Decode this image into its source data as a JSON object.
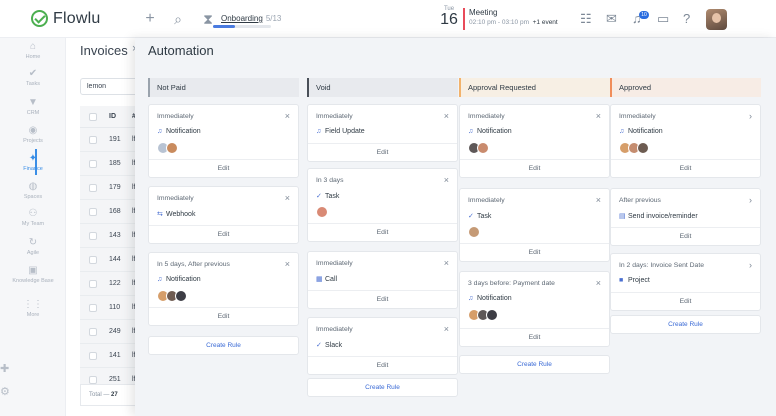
{
  "topbar": {
    "app_name": "Flowlu",
    "onboarding_label": "Onboarding",
    "onboarding_step": "5/13",
    "onboarding_progress": 0.38,
    "calendar_day": "Tue",
    "calendar_date": "16",
    "meeting_title": "Meeting",
    "meeting_time": "02:10 pm - 03:10 pm",
    "meeting_more": "+1 event",
    "notification_count": "10",
    "icons": [
      "plus-icon",
      "search-icon",
      "timer-icon",
      "checklist-icon",
      "mail-icon",
      "bell-icon",
      "chat-icon",
      "help-icon"
    ]
  },
  "sidebar": {
    "items": [
      {
        "label": "Home",
        "glyph": "⌂"
      },
      {
        "label": "Tasks",
        "glyph": "✔"
      },
      {
        "label": "CRM",
        "glyph": "▼"
      },
      {
        "label": "Projects",
        "glyph": "◉"
      },
      {
        "label": "Finance",
        "glyph": "✦"
      },
      {
        "label": "Spaces",
        "glyph": "◍"
      },
      {
        "label": "My Team",
        "glyph": "⚇"
      },
      {
        "label": "Agile",
        "glyph": "↻"
      },
      {
        "label": "Knowledge Base",
        "glyph": "▣"
      },
      {
        "label": "More",
        "glyph": "⋮⋮"
      }
    ],
    "bottom_icons": [
      "puzzle-icon",
      "gear-icon"
    ]
  },
  "invoices": {
    "title": "Invoices",
    "close": "×",
    "search_value": "lemon",
    "col_id": "ID",
    "col_num": "#",
    "rows": [
      {
        "id": "191",
        "n": "lf"
      },
      {
        "id": "185",
        "n": "lf"
      },
      {
        "id": "179",
        "n": "lf"
      },
      {
        "id": "168",
        "n": "lf"
      },
      {
        "id": "143",
        "n": "lf"
      },
      {
        "id": "144",
        "n": "lf"
      },
      {
        "id": "122",
        "n": "lf"
      },
      {
        "id": "110",
        "n": "lf"
      },
      {
        "id": "249",
        "n": "lf"
      },
      {
        "id": "141",
        "n": "lf"
      },
      {
        "id": "251",
        "n": "lf"
      }
    ],
    "total_label": "Total —",
    "total_value": "27"
  },
  "automation": {
    "title": "Automation",
    "columns": [
      {
        "title": "Not Paid",
        "color": "#9aa3ad",
        "create_label": "Create Rule",
        "cards": [
          {
            "timing": "Immediately",
            "icon": "bell-icon",
            "icon_glyph": "♫",
            "action": "Notification",
            "avatars": [
              "#b8c3d3",
              "#c98b5e"
            ],
            "edit": "Edit"
          },
          {
            "timing": "Immediately",
            "icon": "webhook-icon",
            "icon_glyph": "⇆",
            "action": "Webhook",
            "avatars": [],
            "edit": "Edit"
          },
          {
            "timing": "In 5 days, After previous",
            "icon": "bell-icon",
            "icon_glyph": "♫",
            "action": "Notification",
            "avatars": [
              "#d69e6a",
              "#6f5c52",
              "#3d3d45"
            ],
            "edit": "Edit"
          }
        ]
      },
      {
        "title": "Void",
        "color": "#4a5059",
        "create_label": "Create Rule",
        "cards": [
          {
            "timing": "Immediately",
            "icon": "field-icon",
            "icon_glyph": "♫",
            "action": "Field Update",
            "avatars": [],
            "edit": "Edit"
          },
          {
            "timing": "In 3 days",
            "icon": "check-icon",
            "icon_glyph": "✓",
            "action": "Task",
            "avatars": [
              "#d98a75"
            ],
            "edit": "Edit"
          },
          {
            "timing": "Immediately",
            "icon": "calendar-icon",
            "icon_glyph": "▦",
            "action": "Call",
            "avatars": [],
            "edit": "Edit"
          },
          {
            "timing": "Immediately",
            "icon": "check-icon",
            "icon_glyph": "✓",
            "action": "Slack",
            "avatars": [],
            "edit": "Edit"
          }
        ]
      },
      {
        "title": "Approval Requested",
        "color": "#f2b26b",
        "create_label": "Create Rule",
        "cards": [
          {
            "timing": "Immediately",
            "icon": "bell-icon",
            "icon_glyph": "♫",
            "action": "Notification",
            "avatars": [
              "#5e5858",
              "#c98b6e"
            ],
            "edit": "Edit"
          },
          {
            "timing": "Immediately",
            "icon": "check-icon",
            "icon_glyph": "✓",
            "action": "Task",
            "avatars": [
              "#c59a76"
            ],
            "edit": "Edit"
          },
          {
            "timing": "3 days before: Payment date",
            "icon": "bell-icon",
            "icon_glyph": "♫",
            "action": "Notification",
            "avatars": [
              "#d69e6a",
              "#5e5858",
              "#3d3d45"
            ],
            "edit": "Edit"
          }
        ]
      },
      {
        "title": "Approved",
        "color": "#f08d5a",
        "create_label": "Create Rule",
        "cards": [
          {
            "timing": "Immediately",
            "icon": "bell-icon",
            "icon_glyph": "♫",
            "action": "Notification",
            "avatars": [
              "#d69e6a",
              "#c58d70",
              "#6d5c52"
            ],
            "edit": "Edit"
          },
          {
            "timing": "After previous",
            "icon": "invoice-icon",
            "icon_glyph": "▤",
            "action": "Send invoice/reminder",
            "avatars": [],
            "edit": "Edit"
          },
          {
            "timing": "In 2 days: Invoice Sent Date",
            "icon": "project-icon",
            "icon_glyph": "■",
            "action": "Project",
            "avatars": [],
            "edit": "Edit"
          }
        ]
      }
    ]
  }
}
